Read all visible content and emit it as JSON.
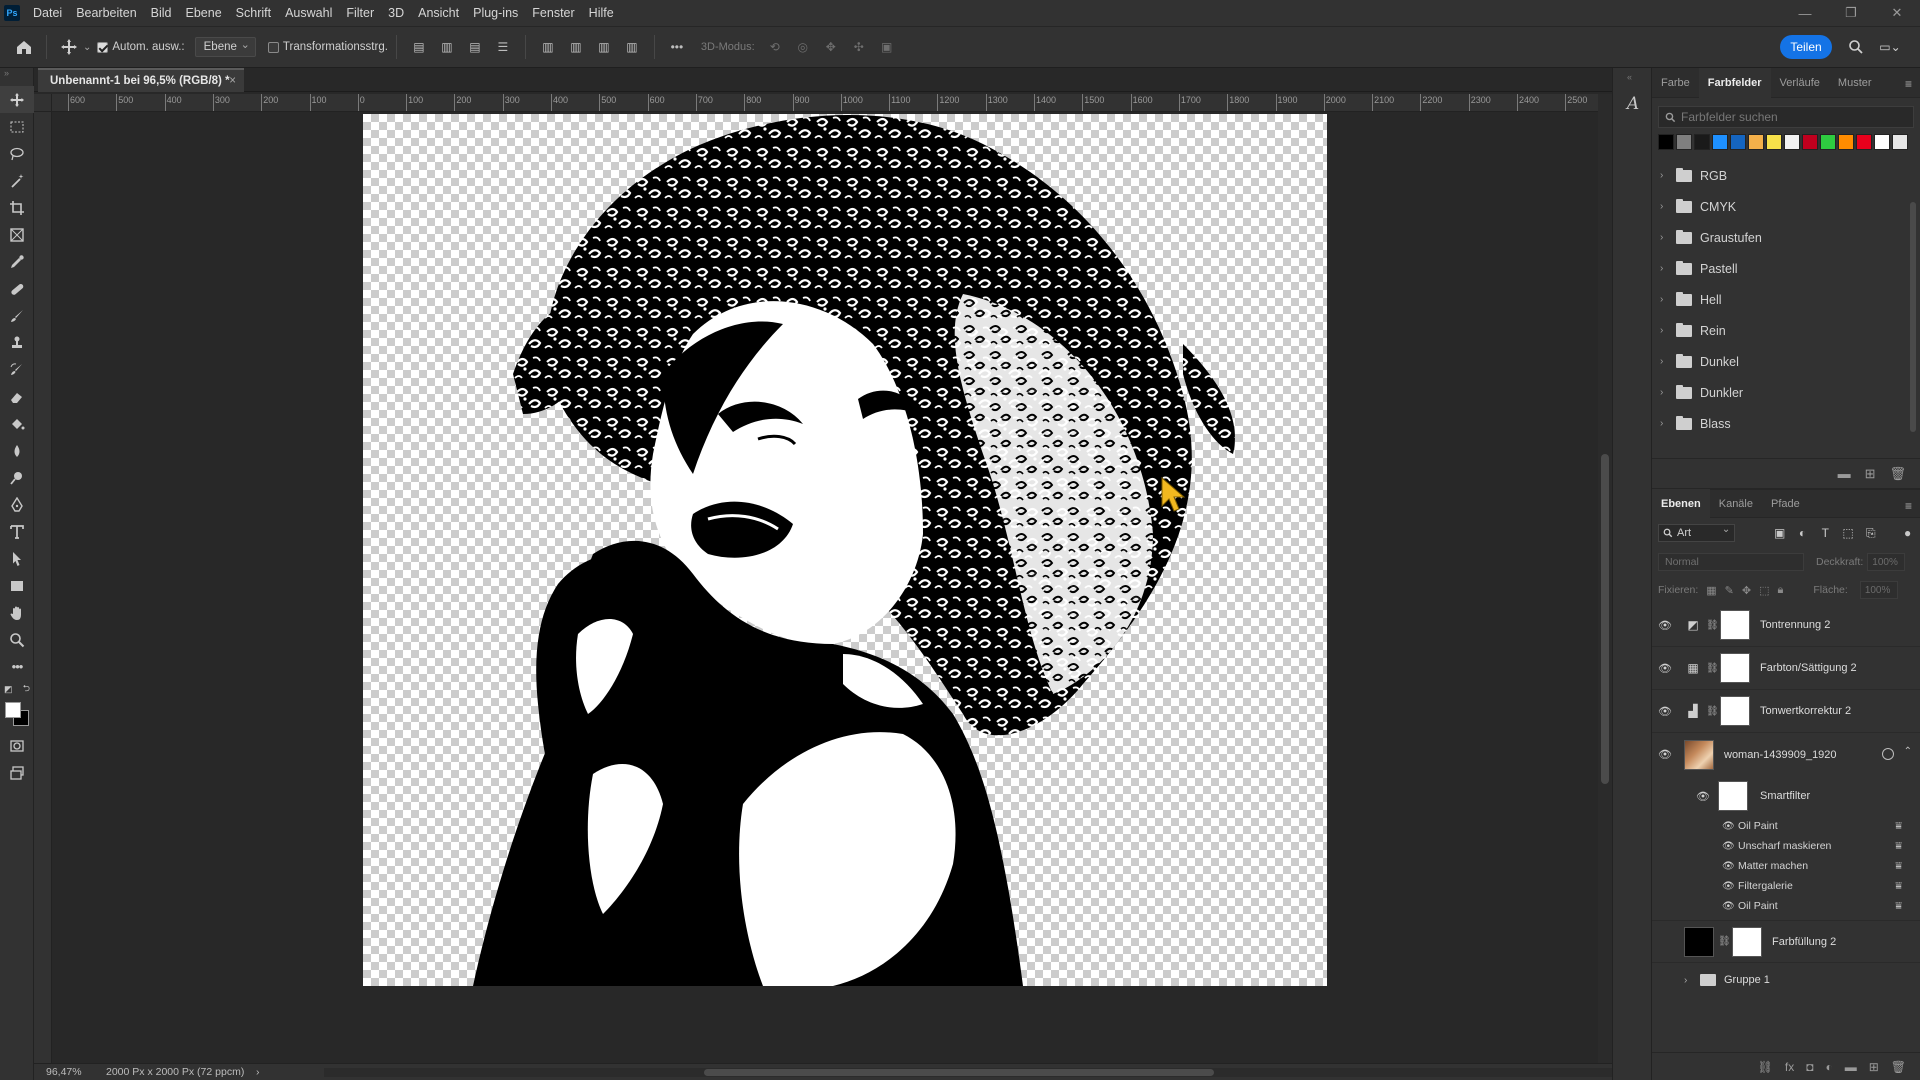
{
  "app": {
    "logo": "Ps",
    "menu": [
      "Datei",
      "Bearbeiten",
      "Bild",
      "Ebene",
      "Schrift",
      "Auswahl",
      "Filter",
      "3D",
      "Ansicht",
      "Plug-ins",
      "Fenster",
      "Hilfe"
    ]
  },
  "options": {
    "auto_select_label": "Autom. ausw.:",
    "auto_select_target": "Ebene",
    "transform_label": "Transformationsstrg.",
    "mode_3d": "3D-Modus:",
    "share_label": "Teilen"
  },
  "document": {
    "tab_title": "Unbenannt-1 bei 96,5% (RGB/8) *",
    "close_glyph": "×"
  },
  "ruler": {
    "h_ticks": [
      "600",
      "500",
      "400",
      "300",
      "200",
      "100",
      "0",
      "100",
      "200",
      "300",
      "400",
      "500",
      "600",
      "700",
      "800",
      "900",
      "1000",
      "1100",
      "1200",
      "1300",
      "1400",
      "1500",
      "1600",
      "1700",
      "1800",
      "1900",
      "2000",
      "2100",
      "2200",
      "2300",
      "2400",
      "2500"
    ]
  },
  "status": {
    "zoom": "96,47%",
    "doc_info": "2000 Px x 2000 Px (72 ppcm)",
    "arrow": "›"
  },
  "swatches_panel": {
    "tabs": [
      "Farbe",
      "Farbfelder",
      "Verläufe",
      "Muster"
    ],
    "active_tab": "Farbfelder",
    "search_placeholder": "Farbfelder suchen",
    "recent_colors": [
      "#000000",
      "#7f7f7f",
      "#1a1a1a",
      "#1e90ff",
      "#1565c0",
      "#f4b04a",
      "#f7e14a",
      "#f2f2f2",
      "#c0001e",
      "#2ecc40",
      "#ff8c00",
      "#e8001c",
      "#ffffff",
      "#e6e6e6"
    ],
    "folders": [
      "RGB",
      "CMYK",
      "Graustufen",
      "Pastell",
      "Hell",
      "Rein",
      "Dunkel",
      "Dunkler",
      "Blass"
    ]
  },
  "layers_panel": {
    "tabs": [
      "Ebenen",
      "Kanäle",
      "Pfade"
    ],
    "active_tab": "Ebenen",
    "filter_kind": "Art",
    "blend_mode": "Normal",
    "opacity_label": "Deckkraft:",
    "opacity_value": "100%",
    "lock_label": "Fixieren:",
    "fill_label": "Fläche:",
    "fill_value": "100%",
    "layers": [
      {
        "name": "Tontrennung 2",
        "icon": "posterize-icon",
        "visible": true
      },
      {
        "name": "Farbton/Sättigung 2",
        "icon": "hue-saturation-icon",
        "visible": true
      },
      {
        "name": "Tonwertkorrektur 2",
        "icon": "levels-icon",
        "visible": true
      }
    ],
    "smart_layer": {
      "name": "woman-1439909_1920",
      "visible": true
    },
    "smart_filters_label": "Smartfilter",
    "smart_filters": [
      "Oil Paint",
      "Unscharf maskieren",
      "Matter machen",
      "Filtergalerie",
      "Oil Paint"
    ],
    "fill_layer": {
      "name": "Farbfüllung 2",
      "visible": false
    },
    "group": {
      "name": "Gruppe 1"
    }
  },
  "colors": {
    "accent": "#1473e6",
    "foreground": "#ffffff",
    "background": "#000000"
  }
}
